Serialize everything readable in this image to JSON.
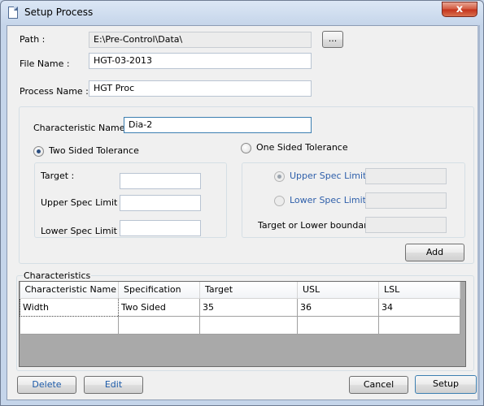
{
  "window": {
    "title": "Setup Process",
    "close_glyph": "x"
  },
  "path": {
    "label": "Path :",
    "value": "E:\\Pre-Control\\Data\\",
    "browse_label": "..."
  },
  "file_name": {
    "label": "File Name :",
    "value": "HGT-03-2013"
  },
  "process_name": {
    "label": "Process Name :",
    "value": "HGT Proc"
  },
  "characteristic": {
    "name_label": "Characteristic Name :",
    "name_value": "Dia-2",
    "two_sided": {
      "label": "Two Sided Tolerance",
      "checked": true,
      "target_label": "Target :",
      "usl_label": "Upper Spec Limit :",
      "lsl_label": "Lower Spec Limit :",
      "target_value": "",
      "usl_value": "",
      "lsl_value": ""
    },
    "one_sided": {
      "label": "One Sided Tolerance",
      "checked": false,
      "upper_label": "Upper Spec Limit",
      "upper_checked": true,
      "lower_label": "Lower Spec Limit",
      "lower_checked": false,
      "boundary_label": "Target or Lower boundary",
      "upper_value": "",
      "lower_value": "",
      "boundary_value": ""
    },
    "add_label": "Add"
  },
  "characteristics": {
    "title": "Characteristics",
    "columns": [
      "Characteristic Name",
      "Specification",
      "Target",
      "USL",
      "LSL"
    ],
    "rows": [
      [
        "Width",
        "Two Sided",
        "35",
        "36",
        "34"
      ],
      [
        "",
        "",
        "",
        "",
        ""
      ]
    ]
  },
  "footer": {
    "delete_label": "Delete",
    "edit_label": "Edit",
    "cancel_label": "Cancel",
    "setup_label": "Setup"
  },
  "colors": {
    "link_blue": "#2e5faa",
    "titlebar": "#c5d5ea",
    "close_red": "#c4331c"
  }
}
